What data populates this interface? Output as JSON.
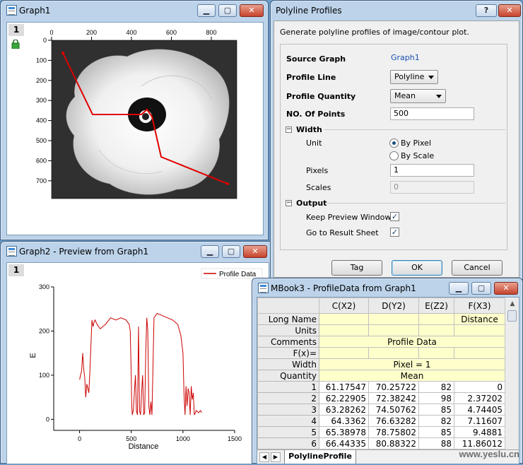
{
  "graph1": {
    "title": "Graph1",
    "page": "1",
    "xticks": [
      "0",
      "200",
      "400",
      "600",
      "800"
    ],
    "yticks": [
      "0",
      "100",
      "200",
      "300",
      "400",
      "500",
      "600",
      "700"
    ]
  },
  "dialog": {
    "title": "Polyline Profiles",
    "help": "?",
    "description": "Generate polyline profiles of image/contour plot.",
    "source_graph_label": "Source Graph",
    "source_graph_value": "Graph1",
    "profile_line_label": "Profile Line",
    "profile_line_value": "Polyline",
    "profile_quantity_label": "Profile Quantity",
    "profile_quantity_value": "Mean",
    "num_points_label": "NO. Of Points",
    "num_points_value": "500",
    "width_label": "Width",
    "unit_label": "Unit",
    "by_pixel": "By Pixel",
    "by_scale": "By Scale",
    "pixels_label": "Pixels",
    "pixels_value": "1",
    "scales_label": "Scales",
    "scales_value": "0",
    "output_label": "Output",
    "keep_preview": "Keep Preview Window",
    "goto_result": "Go to Result Sheet",
    "tag_button": "Tag",
    "ok_button": "OK",
    "cancel_button": "Cancel",
    "collapse_sign": "−"
  },
  "graph2": {
    "title": "Graph2 - Preview from Graph1",
    "page": "1",
    "legend": "Profile Data",
    "line_color": "#cc0000"
  },
  "chart_data": {
    "type": "line",
    "xlabel": "Distance",
    "ylabel": "E",
    "xlim": [
      -250,
      1500
    ],
    "ylim": [
      -25,
      300
    ],
    "xticks": [
      0,
      500,
      1000,
      1500
    ],
    "yticks": [
      0,
      100,
      200,
      300
    ],
    "series": [
      {
        "name": "Profile Data",
        "x": [
          0,
          10,
          20,
          30,
          40,
          50,
          60,
          70,
          80,
          90,
          100,
          110,
          120,
          130,
          140,
          150,
          170,
          200,
          250,
          300,
          350,
          400,
          450,
          480,
          490,
          500,
          505,
          510,
          520,
          530,
          540,
          550,
          560,
          570,
          580,
          590,
          600,
          610,
          620,
          630,
          640,
          650,
          660,
          670,
          680,
          690,
          700,
          720,
          750,
          800,
          850,
          900,
          950,
          980,
          1000,
          1010,
          1020,
          1030,
          1040,
          1050,
          1060,
          1070,
          1080,
          1090,
          1100,
          1110,
          1120,
          1130,
          1150,
          1170,
          1180
        ],
        "y": [
          90,
          100,
          110,
          150,
          115,
          95,
          50,
          80,
          70,
          60,
          110,
          170,
          225,
          210,
          220,
          225,
          215,
          205,
          215,
          230,
          225,
          230,
          225,
          215,
          200,
          100,
          30,
          10,
          20,
          60,
          100,
          20,
          10,
          210,
          20,
          10,
          60,
          100,
          10,
          15,
          150,
          230,
          200,
          30,
          10,
          40,
          10,
          230,
          240,
          235,
          230,
          225,
          215,
          190,
          150,
          60,
          10,
          75,
          30,
          70,
          60,
          10,
          75,
          45,
          60,
          10,
          15,
          20,
          15,
          20,
          15
        ]
      }
    ]
  },
  "mbook": {
    "title": "MBook3 - ProfileData from Graph1",
    "columns": [
      "C(X2)",
      "D(Y2)",
      "E(Z2)",
      "F(X3)"
    ],
    "meta_rows": [
      {
        "label": "Long Name",
        "cells": [
          "",
          "",
          "",
          "Distance"
        ]
      },
      {
        "label": "Units",
        "cells": [
          "",
          "",
          "",
          ""
        ]
      },
      {
        "label": "Comments",
        "merged": "Profile Data"
      },
      {
        "label": "F(x)=",
        "cells": [
          "",
          "",
          "",
          ""
        ]
      },
      {
        "label": "Width",
        "merged": "Pixel = 1"
      },
      {
        "label": "Quantity",
        "merged": "Mean"
      }
    ],
    "rows": [
      {
        "n": "1",
        "c": "61.17547",
        "d": "70.25722",
        "e": "82",
        "f": "0"
      },
      {
        "n": "2",
        "c": "62.22905",
        "d": "72.38242",
        "e": "98",
        "f": "2.37202"
      },
      {
        "n": "3",
        "c": "63.28262",
        "d": "74.50762",
        "e": "85",
        "f": "4.74405"
      },
      {
        "n": "4",
        "c": "64.3362",
        "d": "76.63282",
        "e": "82",
        "f": "7.11607"
      },
      {
        "n": "5",
        "c": "65.38978",
        "d": "78.75802",
        "e": "85",
        "f": "9.4881"
      },
      {
        "n": "6",
        "c": "66.44335",
        "d": "80.88322",
        "e": "88",
        "f": "11.86012"
      }
    ],
    "sheet_tab": "PolylineProfile"
  },
  "watermark": "www.yeslu.cn"
}
